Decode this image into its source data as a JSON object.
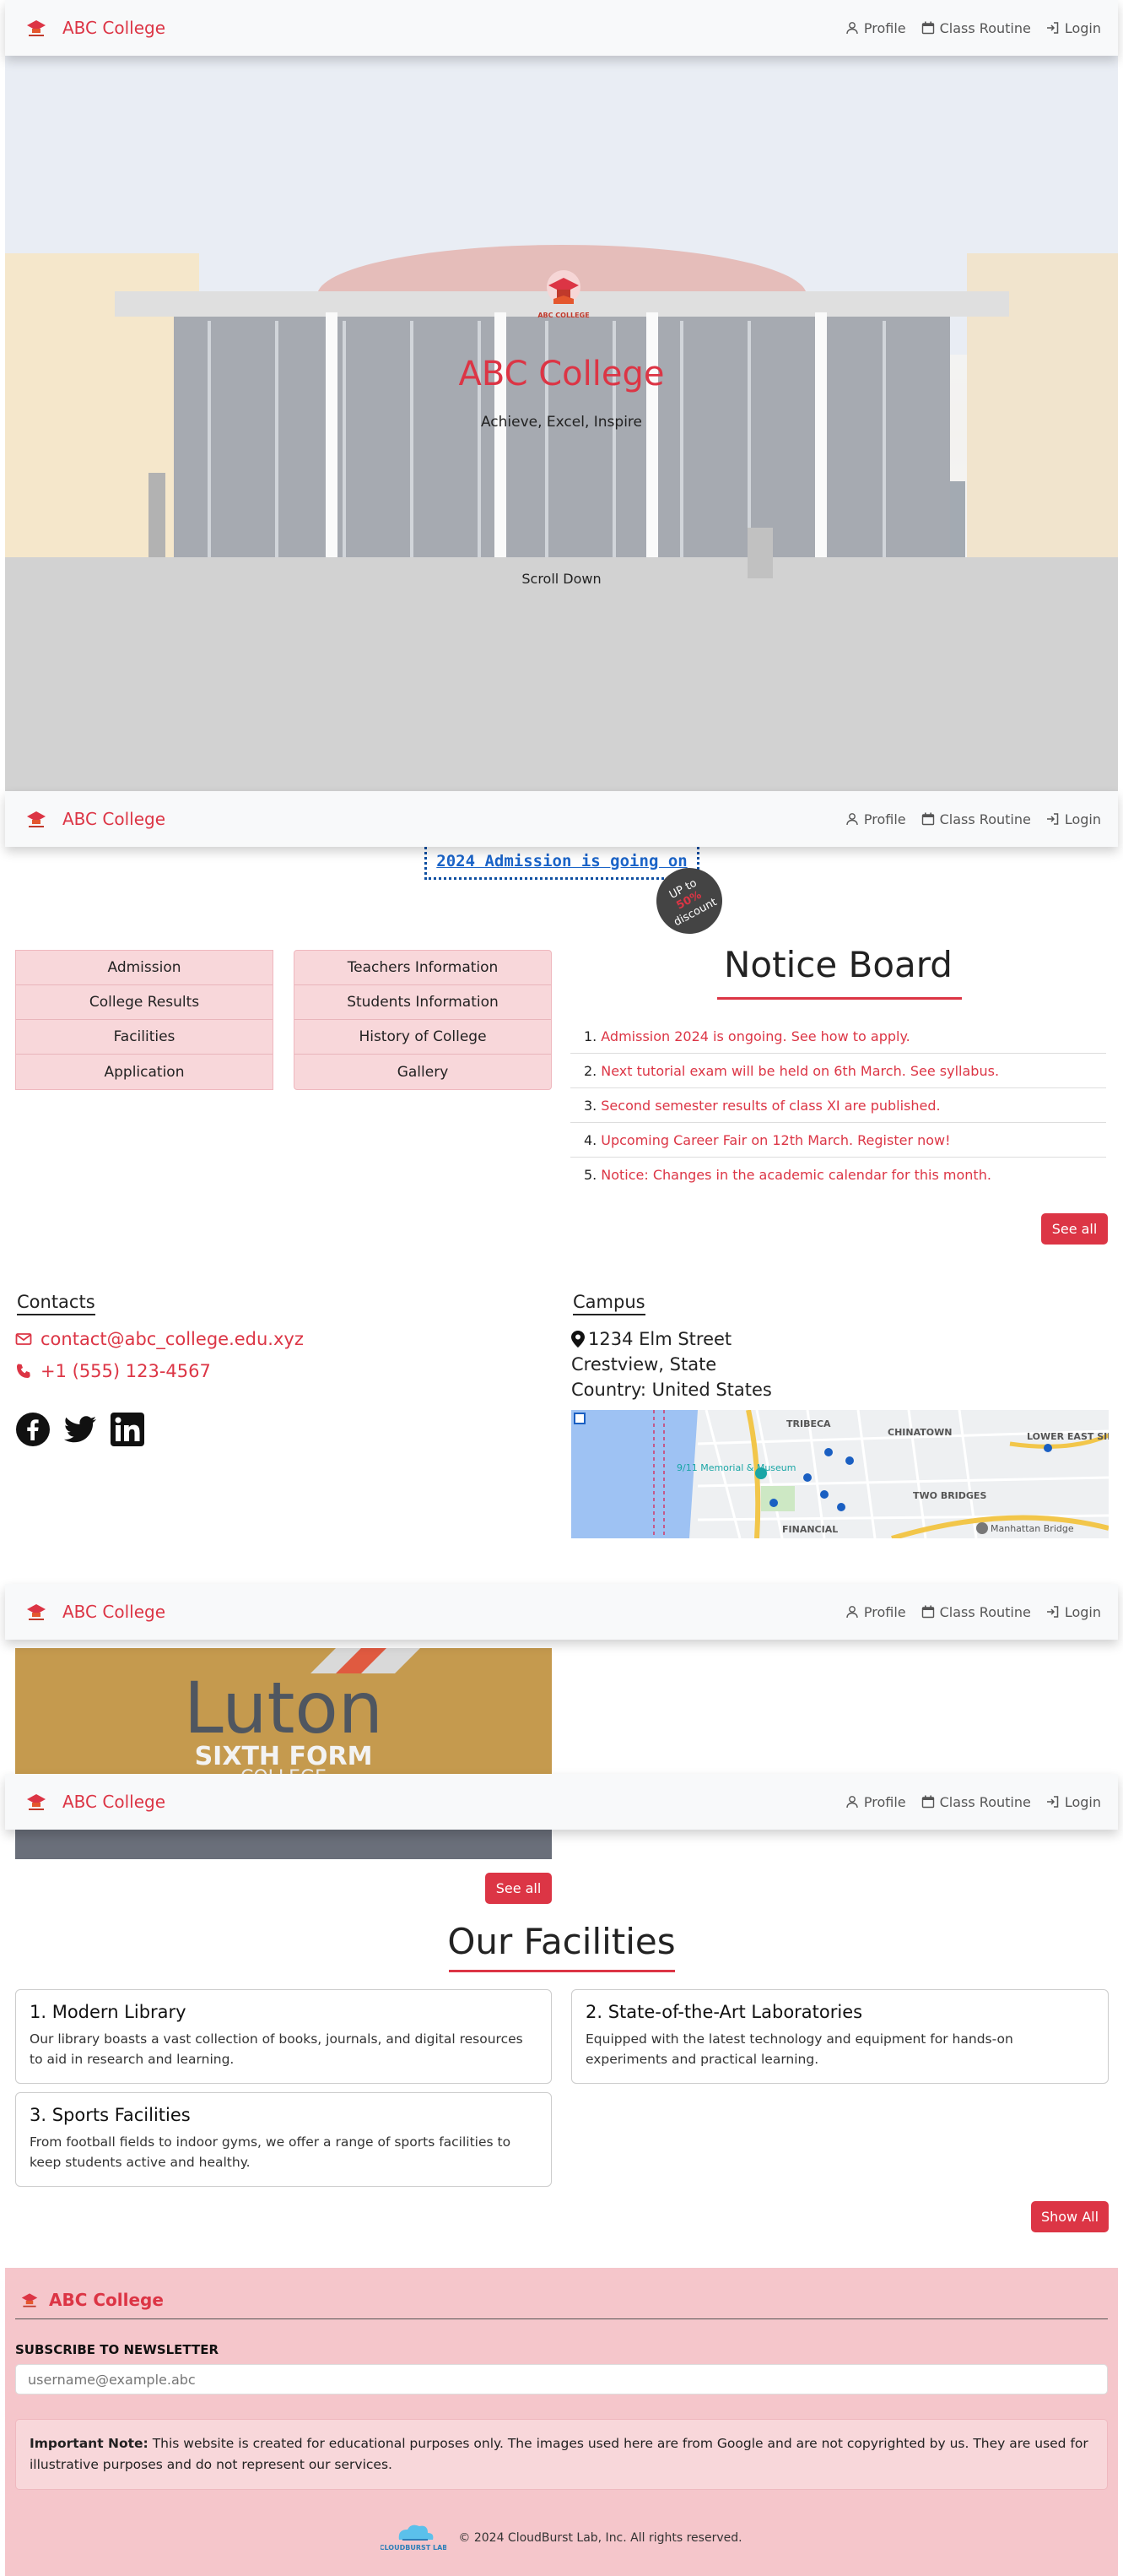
{
  "navbar": {
    "brand": "ABC College",
    "links": [
      {
        "label": "Profile",
        "icon": "user-icon"
      },
      {
        "label": "Class Routine",
        "icon": "calendar-icon"
      },
      {
        "label": "Login",
        "icon": "sign-in-icon"
      }
    ]
  },
  "hero": {
    "title": "ABC College",
    "tagline": "Achieve, Excel, Inspire",
    "scroll_label": "Scroll Down",
    "logo_text": "ABC COLLEGE"
  },
  "admission": {
    "banner": "2024 Admission is going on",
    "badge_top": "UP to",
    "badge_pct": "50%",
    "badge_bottom": "discount"
  },
  "links_left": [
    "Admission",
    "College Results",
    "Facilities",
    "Application"
  ],
  "links_middle": [
    "Teachers Information",
    "Students Information",
    "History of College",
    "Gallery"
  ],
  "notice_board": {
    "title": "Notice Board",
    "items": [
      "Admission 2024 is ongoing. See how to apply.",
      "Next tutorial exam will be held on 6th March. See syllabus.",
      "Second semester results of class XI are published.",
      "Upcoming Career Fair on 12th March. Register now!",
      "Notice: Changes in the academic calendar for this month."
    ],
    "see_all": "See all"
  },
  "contacts": {
    "heading": "Contacts",
    "email": "contact@abc_college.edu.xyz",
    "phone": "+1 (555) 123-4567",
    "socials": [
      "facebook-icon",
      "twitter-icon",
      "linkedin-icon"
    ]
  },
  "campus": {
    "heading": "Campus",
    "street": "1234 Elm Street",
    "city": "Crestview, State",
    "country": "Country: United States",
    "map_labels": [
      "TRIBECA",
      "CHINATOWN",
      "LOWER EAST SIDE",
      "9/11 Memorial & Museum",
      "TWO BRIDGES",
      "FINANCIAL",
      "Manhattan Bridge"
    ]
  },
  "gallery": {
    "see_all": "See all",
    "photo_text_1": "Luton",
    "photo_text_2": "SIXTH FORM",
    "photo_text_3": "COLLEGE"
  },
  "facilities": {
    "title": "Our Facilities",
    "cards": [
      {
        "title": "1. Modern Library",
        "text": "Our library boasts a vast collection of books, journals, and digital resources to aid in research and learning."
      },
      {
        "title": "2. State-of-the-Art Laboratories",
        "text": "Equipped with the latest technology and equipment for hands-on experiments and practical learning."
      },
      {
        "title": "3. Sports Facilities",
        "text": "From football fields to indoor gyms, we offer a range of sports facilities to keep students active and healthy."
      }
    ],
    "show_all": "Show All"
  },
  "footer": {
    "brand": "ABC College",
    "subscribe_label": "SUBSCRIBE TO NEWSLETTER",
    "email_placeholder": "username@example.abc",
    "note_label": "Important Note:",
    "note_text": " This website is created for educational purposes only. The images used here are from Google and are not copyrighted by us. They are used for illustrative purposes and do not represent our services.",
    "logo_text": "CLOUDBURST LAB",
    "copyright": "© 2024 CloudBurst Lab, Inc. All rights reserved."
  },
  "colors": {
    "accent": "#dc3545",
    "pink_bg": "#f8d7da",
    "footer_bg": "#f5c6cb"
  }
}
